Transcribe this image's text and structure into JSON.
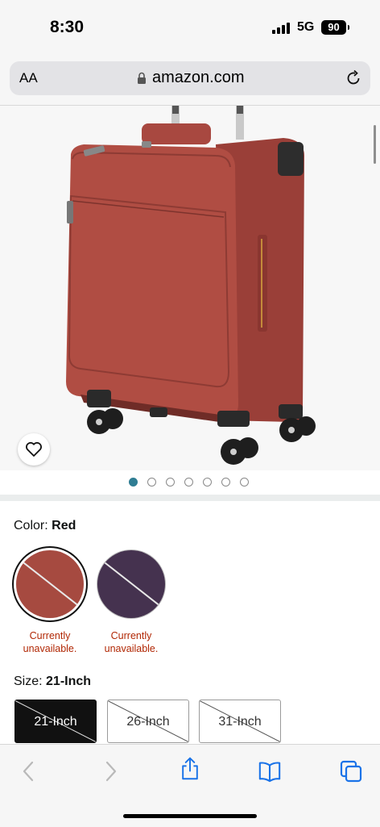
{
  "status": {
    "time": "8:30",
    "network": "5G",
    "battery": "90"
  },
  "browser": {
    "text_size_label": "AA",
    "url": "amazon.com"
  },
  "gallery": {
    "image_count": 7,
    "active_index": 0,
    "accent": "#2f7d93"
  },
  "color": {
    "label": "Color:",
    "selected": "Red",
    "options": [
      {
        "name": "Red",
        "hex": "#a64a40",
        "status": "Currently unavailable."
      },
      {
        "name": "Purple",
        "hex": "#45324f",
        "status": "Currently unavailable."
      }
    ]
  },
  "size": {
    "label": "Size:",
    "selected": "21-Inch",
    "options": [
      "21-Inch",
      "26-Inch",
      "31-Inch"
    ]
  },
  "toolbar": {
    "icons": [
      "back-icon",
      "forward-icon",
      "share-icon",
      "bookmarks-icon",
      "tabs-icon"
    ]
  }
}
